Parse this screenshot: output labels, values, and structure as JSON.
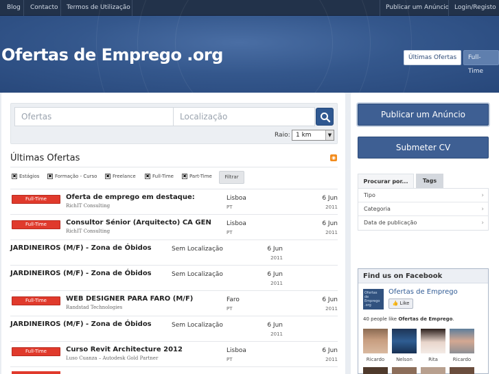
{
  "topbar": {
    "left_links": [
      "Blog",
      "Contacto",
      "Termos de Utilização"
    ],
    "right_links": [
      "Publicar um Anúncio",
      "Login/Registo"
    ]
  },
  "header": {
    "site_title": "Ofertas de Emprego .org",
    "buttons": [
      "Últimas Ofertas",
      "Full-Time"
    ]
  },
  "search": {
    "offers_placeholder": "Ofertas",
    "location_placeholder": "Localização",
    "radius_label": "Raio:",
    "radius_value": "1 km"
  },
  "listing": {
    "title": "Últimas Ofertas",
    "filters": [
      "Estágios",
      "Formação - Curso",
      "Freelance",
      "Full-Time",
      "Part-Time"
    ],
    "filter_button": "Filtrar",
    "rows": [
      {
        "badge": "Full-Time",
        "title": "Oferta de emprego em destaque:",
        "company": "RichIT Consulting",
        "location": "Lisboa",
        "country": "PT",
        "day": "6 Jun",
        "year": "2011"
      },
      {
        "badge": "Full-Time",
        "title": "Consultor Sénior (Arquitecto) CA GEN",
        "company": "RichIT Consulting",
        "location": "Lisboa",
        "country": "PT",
        "day": "6 Jun",
        "year": "2011"
      },
      {
        "badge": "",
        "title": "JARDINEIROS (M/F) - Zona de Óbidos",
        "company": "",
        "location": "Sem Localização",
        "country": "",
        "day": "6 Jun",
        "year": "2011"
      },
      {
        "badge": "",
        "title": "JARDINEIROS (M/F) - Zona de Óbidos",
        "company": "",
        "location": "Sem Localização",
        "country": "",
        "day": "6 Jun",
        "year": "2011"
      },
      {
        "badge": "Full-Time",
        "title": "WEB DESIGNER PARA FARO (M/F)",
        "company": "Randstad Technologies",
        "location": "Faro",
        "country": "PT",
        "day": "6 Jun",
        "year": "2011"
      },
      {
        "badge": "",
        "title": "JARDINEIROS (M/F) - Zona de Óbidos",
        "company": "",
        "location": "Sem Localização",
        "country": "",
        "day": "6 Jun",
        "year": "2011"
      },
      {
        "badge": "Full-Time",
        "title": "Curso Revit Architecture 2012",
        "company": "Luso Cuanza – Autodesk Gold Partner",
        "location": "Lisboa",
        "country": "PT",
        "day": "6 Jun",
        "year": "2011"
      }
    ]
  },
  "sidebar": {
    "publish_button": "Publicar um Anúncio",
    "cv_button": "Submeter CV",
    "tabs": [
      "Procurar por...",
      "Tags"
    ],
    "browse_items": [
      "Tipo",
      "Categoria",
      "Data de publicação"
    ],
    "facebook": {
      "heading": "Find us on Facebook",
      "logo_text": "Ofertas de Emprego .org",
      "page_name": "Ofertas de Emprego",
      "like_label": "Like",
      "count_prefix": "40 people like ",
      "count_page": "Ofertas de Emprego",
      "count_suffix": ".",
      "fans": [
        "Ricardo",
        "Nelson",
        "Rita",
        "Ricardo"
      ]
    }
  },
  "colors": {
    "topbar": "#22324a",
    "header": "#34578c",
    "badge": "#e03a2c",
    "button": "#3e5f93"
  }
}
